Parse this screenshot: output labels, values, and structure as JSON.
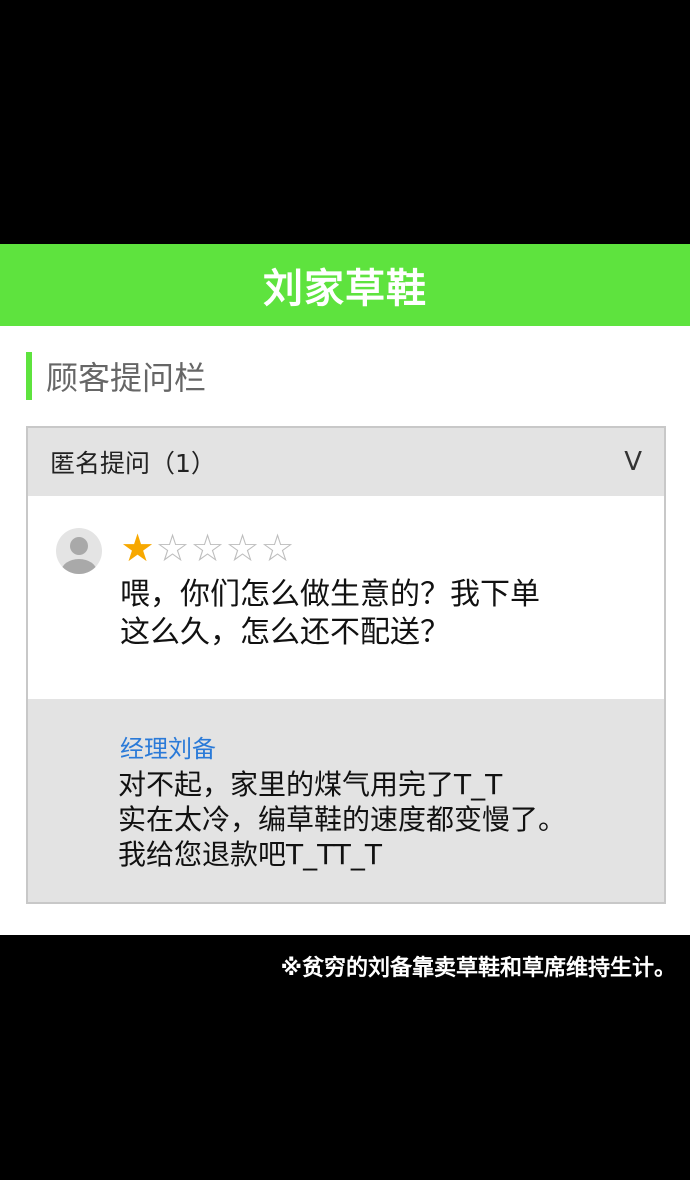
{
  "header": {
    "title": "刘家草鞋"
  },
  "section": {
    "title": "顾客提问栏"
  },
  "qa": {
    "header_label": "匿名提问（1）",
    "chevron": "V",
    "question": {
      "rating": 1,
      "rating_max": 5,
      "star_filled": "★",
      "star_empty": "☆",
      "text": "喂，你们怎么做生意的？我下单\n这么久，怎么还不配送？"
    },
    "answer": {
      "author": "经理刘备",
      "text": "对不起，家里的煤气用完了T_T\n实在太冷，编草鞋的速度都变慢了。\n我给您退款吧T_TT_T"
    }
  },
  "caption": "※贫穷的刘备靠卖草鞋和草席维持生计。",
  "colors": {
    "brand_green": "#5ee33e",
    "star_gold": "#f7a800",
    "author_blue": "#2a7ad8"
  }
}
